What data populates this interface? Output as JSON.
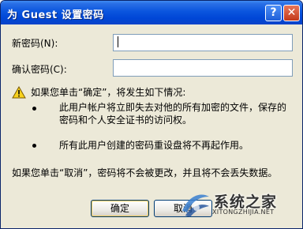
{
  "window": {
    "title": "为 Guest 设置密码",
    "help_glyph": "?",
    "close_glyph": "✕"
  },
  "form": {
    "new_password": {
      "label": "新密码(N):",
      "value": ""
    },
    "confirm_password": {
      "label": "确认密码(C):",
      "value": ""
    }
  },
  "warning": {
    "heading": "如果您单击“确定”，将发生如下情况:",
    "bullets": [
      {
        "line1": "此用户帐户将立即失去对他的所有加密的文件，保存的",
        "line2": "密码和个人安全证书的访问权。"
      },
      {
        "line1": "所有此用户创建的密码重设盘将不再起作用。"
      }
    ],
    "cancel_note": "如果您单击“取消”，密码将不会被更改，并且将不会丢失数据。"
  },
  "buttons": {
    "ok": "确定",
    "cancel": "取消"
  },
  "watermark": {
    "name": "系统之家",
    "url": "XITONGZHIJIA.NET"
  }
}
